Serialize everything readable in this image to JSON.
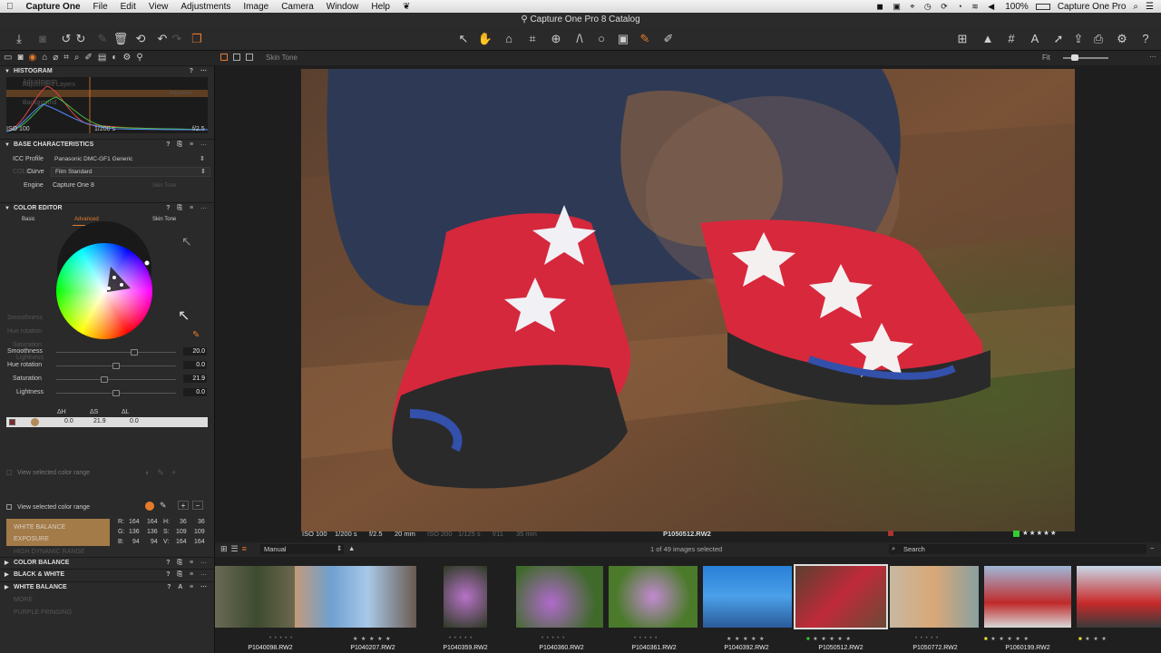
{
  "menubar": {
    "app": "Capture One",
    "items": [
      "File",
      "Edit",
      "View",
      "Adjustments",
      "Image",
      "Camera",
      "Window",
      "Help"
    ],
    "battery": "100%",
    "right_app": "Capture One Pro"
  },
  "window_title": "Capture One Pro 8 Catalog",
  "viewer_toolbar": {
    "preset_label": "Skin Tone",
    "fit_label": "Fit"
  },
  "histogram": {
    "title": "HISTOGRAM",
    "ghost_layers": [
      "Adjustments",
      "Adjustment Layers",
      "Background",
      "Adjustment"
    ],
    "iso": "ISO 100",
    "shutter": "1/200 s",
    "aperture": "f/2.5"
  },
  "base_characteristics": {
    "title": "BASE CHARACTERISTICS",
    "icc_label": "ICC Profile",
    "icc_value": "Panasonic DMC-GF1 Generic",
    "ghost_label": "COLOR",
    "curve_label": "Curve",
    "curve_value": "Film Standard",
    "engine_label": "Engine",
    "engine_value": "Capture One 8",
    "ghost_tab": "Skin Tone"
  },
  "color_editor": {
    "title": "COLOR EDITOR",
    "tabs": [
      "Basic",
      "Advanced",
      "Skin Tone"
    ],
    "active_tab": "Advanced",
    "ghost_labels": [
      "Smoothness",
      "Hue rotation",
      "Saturation",
      "Lightness"
    ],
    "sliders": [
      {
        "label": "Smoothness",
        "value": "20.0",
        "pos": 0.65
      },
      {
        "label": "Hue rotation",
        "value": "0.0",
        "pos": 0.5
      },
      {
        "label": "Saturation",
        "value": "21.9",
        "pos": 0.4
      },
      {
        "label": "Lightness",
        "value": "0.0",
        "pos": 0.5
      }
    ],
    "delta_headers": [
      "ΔH",
      "ΔS",
      "ΔL"
    ],
    "delta_values": [
      "0.0",
      "21.9",
      "0.0"
    ],
    "view_range_ghost": "View selected color range",
    "view_range": "View selected color range",
    "rgb": {
      "r_label": "R:",
      "r": [
        "164",
        "164"
      ],
      "h_label": "H:",
      "h": [
        "36",
        "36"
      ],
      "g_label": "G:",
      "g": [
        "136",
        "136"
      ],
      "s_label": "S:",
      "s": [
        "109",
        "109"
      ],
      "b_label": "B:",
      "b": [
        "94",
        "94"
      ],
      "v_label": "V:",
      "v": [
        "164",
        "164"
      ]
    }
  },
  "ghost_sections": [
    "WHITE BALANCE",
    "EXPOSURE",
    "HIGH DYNAMIC RANGE",
    "MORE",
    "PURPLE FRINGING"
  ],
  "sections": [
    "COLOR BALANCE",
    "BLACK & WHITE",
    "WHITE BALANCE"
  ],
  "viewer": {
    "info_iso": "ISO 100",
    "info_shutter": "1/200 s",
    "info_aperture": "f/2.5",
    "info_focal": "20 mm",
    "ghost_iso": "ISO 200",
    "ghost_shutter": "1/125 s",
    "ghost_aperture": "f/11",
    "ghost_focal": "35 mm",
    "filename": "P1050512.RW2"
  },
  "browser": {
    "sort": "Manual",
    "count": "1 of 49 images selected",
    "search_placeholder": "Search"
  },
  "filmstrip": [
    {
      "name": "P1040098.RW2"
    },
    {
      "name": "P1040207.RW2"
    },
    {
      "name": "P1040359.RW2"
    },
    {
      "name": "P1040360.RW2"
    },
    {
      "name": "P1040361.RW2"
    },
    {
      "name": "P1040392.RW2"
    },
    {
      "name": "P1050512.RW2"
    },
    {
      "name": "P1050772.RW2"
    },
    {
      "name": "P1060199.RW2"
    }
  ],
  "colors": {
    "accent": "#e87b2a",
    "bg": "#2a2a2a"
  }
}
